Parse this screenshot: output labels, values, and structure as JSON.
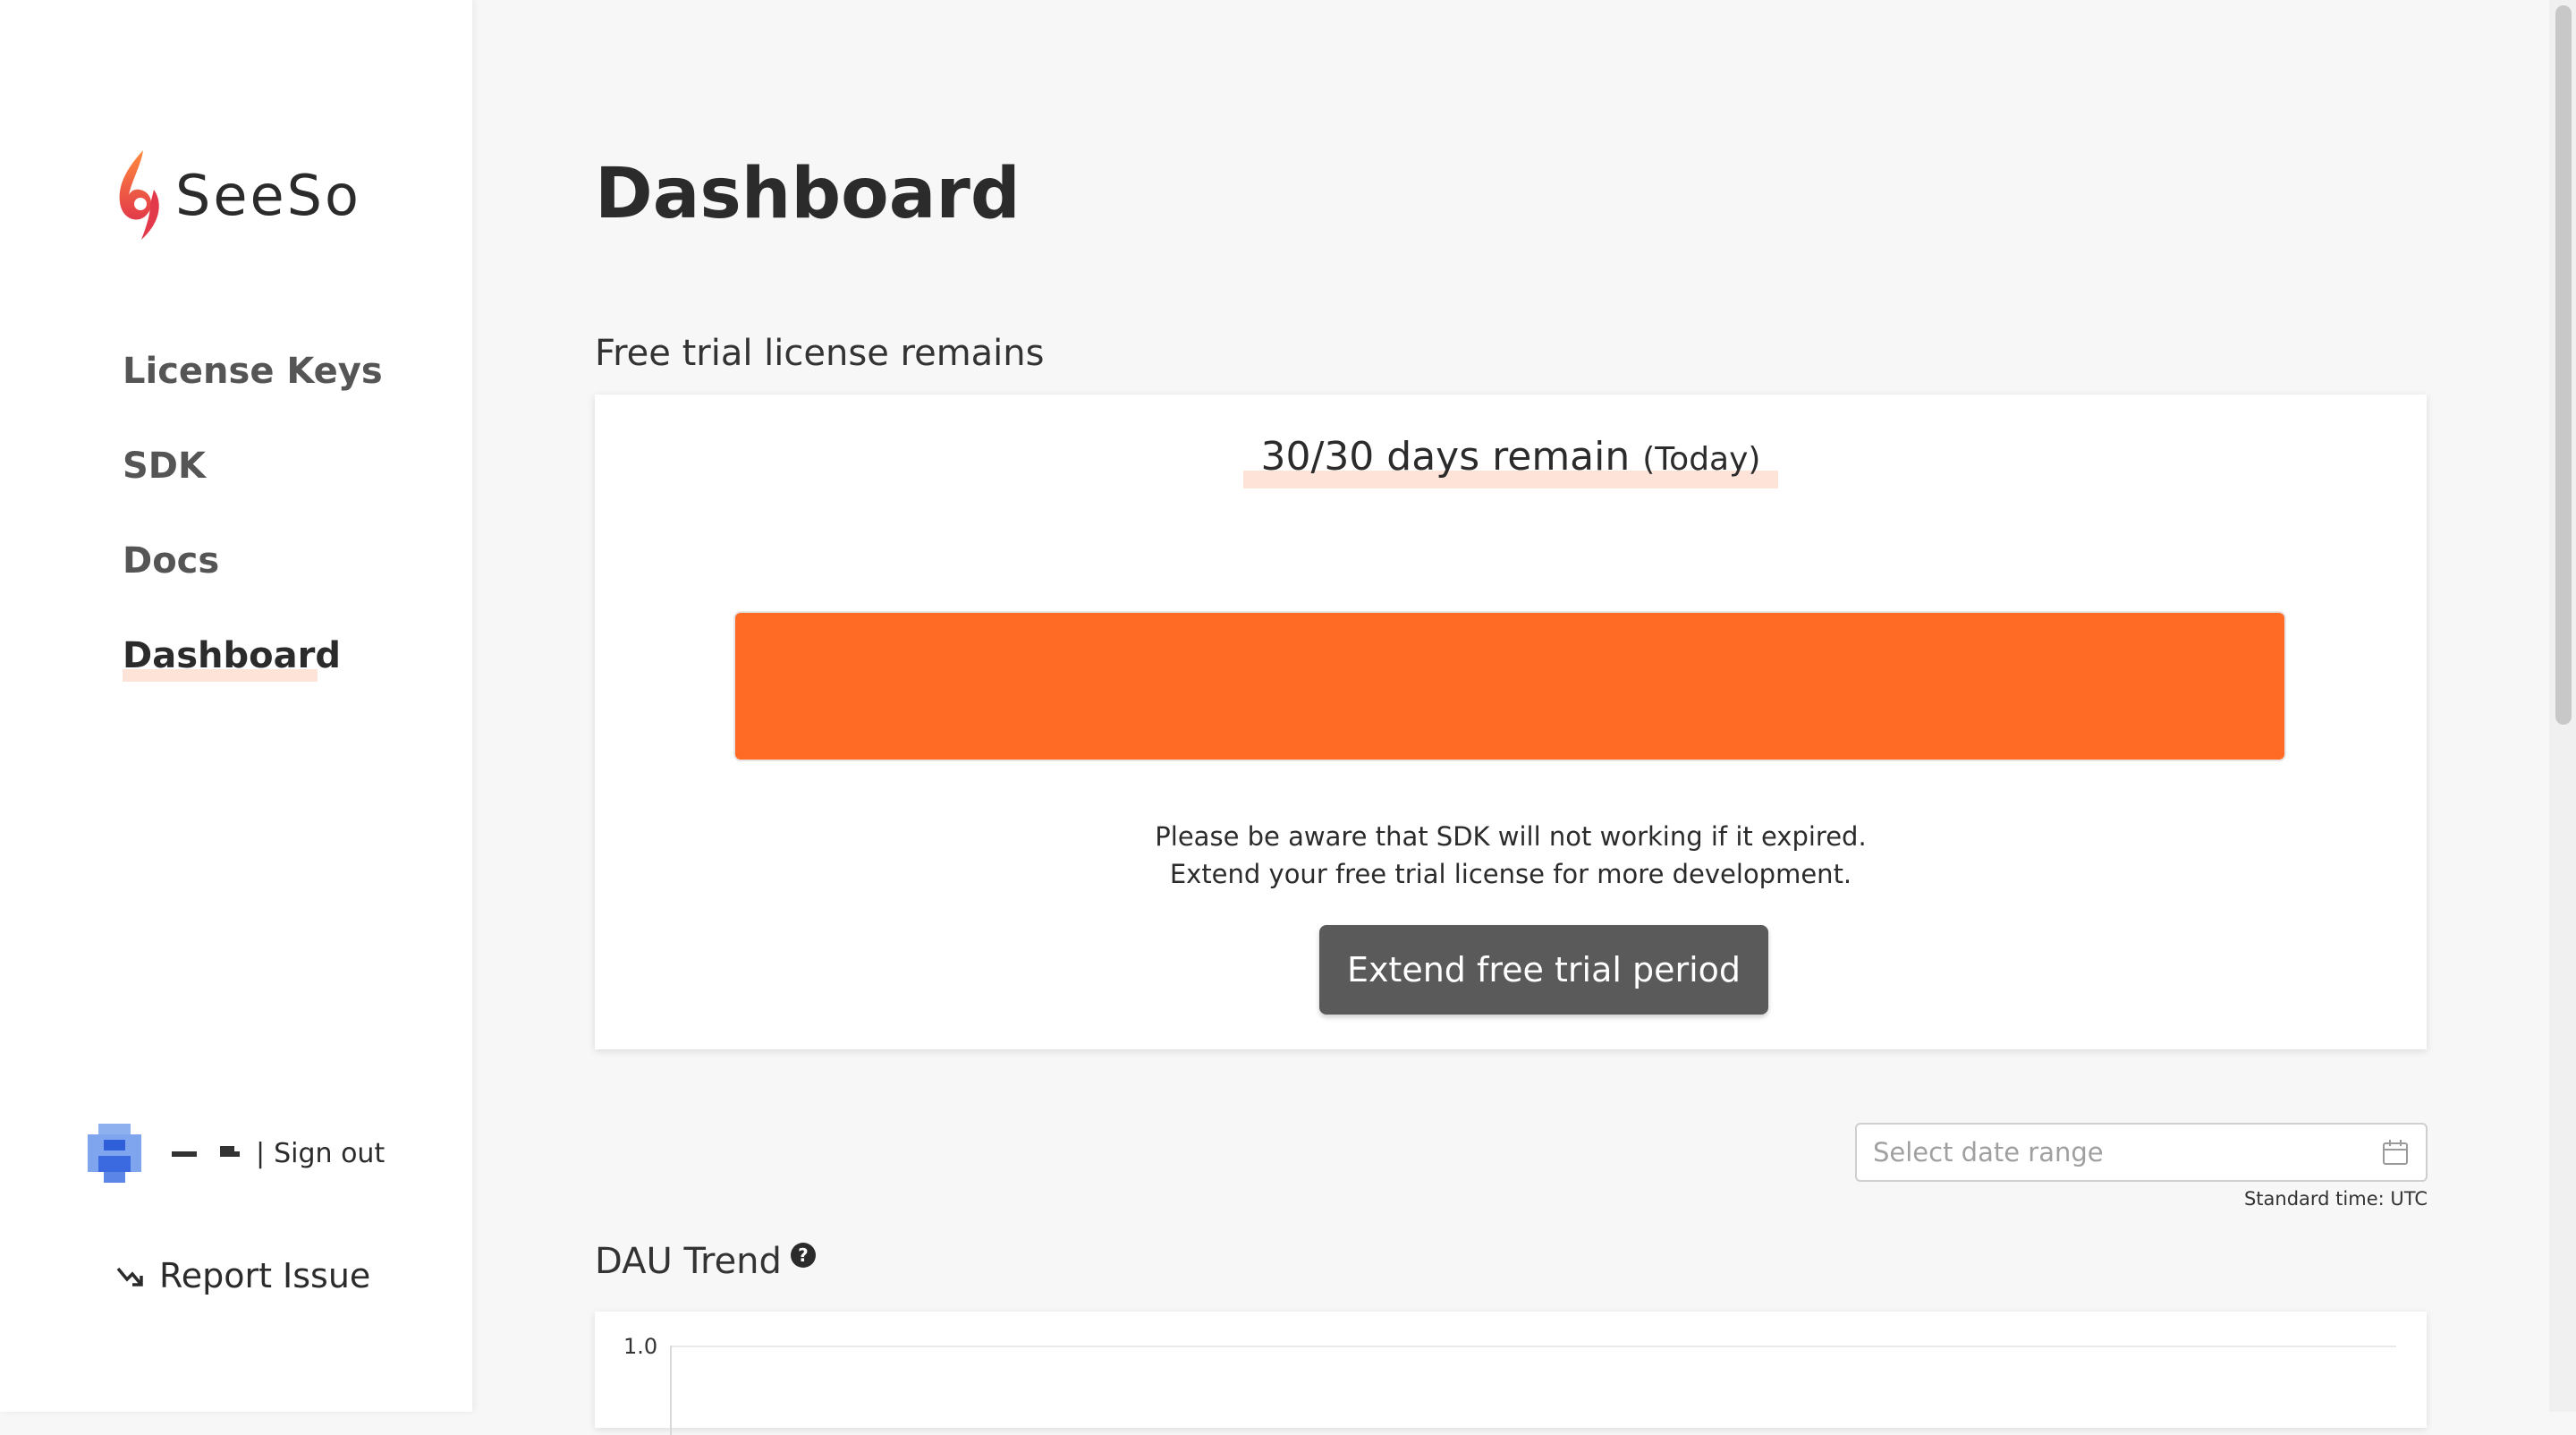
{
  "app": {
    "name": "SeeSo"
  },
  "sidebar": {
    "items": [
      {
        "label": "License Keys"
      },
      {
        "label": "SDK"
      },
      {
        "label": "Docs"
      },
      {
        "label": "Dashboard",
        "active": true
      }
    ],
    "user": {
      "separator": "|",
      "sign_out": "Sign out"
    },
    "report_issue": "Report Issue"
  },
  "main": {
    "title": "Dashboard",
    "trial": {
      "section_label": "Free trial license remains",
      "remain_main": "30/30 days remain",
      "remain_sub": "(Today)",
      "progress_fraction": 1.0,
      "notice_line1": "Please be aware that SDK will not working if it expired.",
      "notice_line2": "Extend your free trial license for more development.",
      "extend_button": "Extend free trial period"
    },
    "date_filter": {
      "placeholder": "Select date range",
      "timezone_note": "Standard time: UTC"
    },
    "dau": {
      "label": "DAU Trend",
      "help_symbol": "?",
      "y_tick_top": "1.0"
    }
  },
  "colors": {
    "accent": "#ff6b24",
    "highlight": "#fde3d8",
    "button": "#5a5a5a"
  },
  "icons": {
    "logo": "seeso-logo-icon",
    "calendar": "calendar-icon",
    "report": "trend-arrow-icon",
    "help": "help-icon"
  }
}
